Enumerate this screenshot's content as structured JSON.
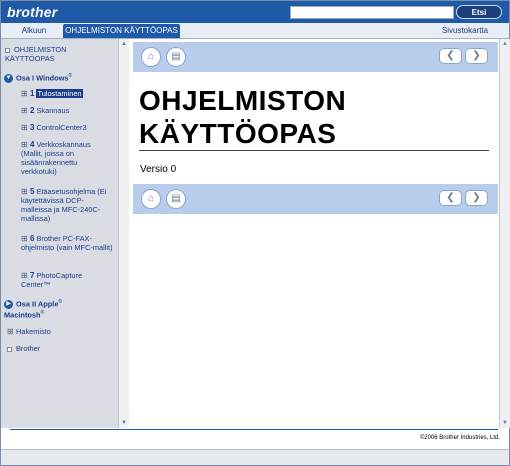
{
  "header": {
    "logo": "brother",
    "search_placeholder": "",
    "search_button": "Etsi"
  },
  "tabs": {
    "home": "Alkuun",
    "active": "OHJELMISTON KÄYTTÖOPAS",
    "sitemap": "Sivustokartta"
  },
  "sidebar": {
    "root": "OHJELMISTON KÄYTTÖOPAS",
    "part1": "Osa I Windows",
    "part1_sup": "®",
    "items": [
      {
        "num": "1",
        "label": "Tulostaminen"
      },
      {
        "num": "2",
        "label": "Skannaus"
      },
      {
        "num": "3",
        "label": "ControlCenter3"
      },
      {
        "num": "4",
        "label": "Verkkoskannaus (Mallit, joissa on sisäänrakennettu verkkotuki)"
      },
      {
        "num": "5",
        "label": "Etäasetusohjelma (Ei käytettävissä DCP-malleissa ja MFC-240C-mallissa)"
      },
      {
        "num": "6",
        "label": "Brother PC-FAX-ohjelmisto (vain MFC-mallit)"
      },
      {
        "num": "7",
        "label": "PhotoCapture Center™"
      }
    ],
    "part2_a": "Osa II Apple",
    "part2_b": "Macintosh",
    "part2_sup": "®",
    "hakemisto": "Hakemisto",
    "brother": "Brother"
  },
  "main": {
    "title": "OHJELMISTON KÄYTTÖOPAS",
    "version": "Versio 0"
  },
  "footer": {
    "copyright": "©2006 Brother Industries, Ltd."
  }
}
